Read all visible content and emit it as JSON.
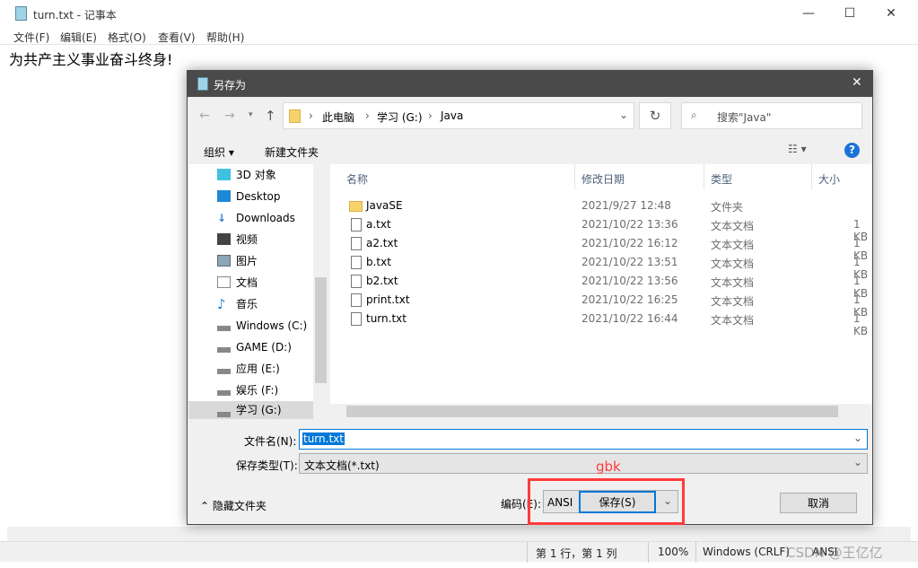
{
  "notepad": {
    "title": "turn.txt - 记事本",
    "menu": [
      "文件(F)",
      "编辑(E)",
      "格式(O)",
      "查看(V)",
      "帮助(H)"
    ],
    "content": "为共产主义事业奋斗终身!",
    "status": {
      "position": "第 1 行，第 1 列",
      "zoom": "100%",
      "line_ending": "Windows (CRLF)",
      "encoding": "ANSI"
    },
    "watermark": "CSDN @王亿亿"
  },
  "dialog": {
    "title": "另存为",
    "breadcrumb": [
      "此电脑",
      "学习 (G:)",
      "Java"
    ],
    "search_placeholder": "搜索\"Java\"",
    "organize": "组织",
    "new_folder": "新建文件夹",
    "nav": [
      "3D 对象",
      "Desktop",
      "Downloads",
      "视频",
      "图片",
      "文档",
      "音乐",
      "Windows (C:)",
      "GAME (D:)",
      "应用 (E:)",
      "娱乐 (F:)",
      "学习 (G:)"
    ],
    "columns": [
      "名称",
      "修改日期",
      "类型",
      "大小"
    ],
    "files": [
      {
        "name": "JavaSE",
        "date": "2021/9/27 12:48",
        "type": "文件夹",
        "size": ""
      },
      {
        "name": "a.txt",
        "date": "2021/10/22 13:36",
        "type": "文本文档",
        "size": "1 KB"
      },
      {
        "name": "a2.txt",
        "date": "2021/10/22 16:12",
        "type": "文本文档",
        "size": "1 KB"
      },
      {
        "name": "b.txt",
        "date": "2021/10/22 13:51",
        "type": "文本文档",
        "size": "1 KB"
      },
      {
        "name": "b2.txt",
        "date": "2021/10/22 13:56",
        "type": "文本文档",
        "size": "1 KB"
      },
      {
        "name": "print.txt",
        "date": "2021/10/22 16:25",
        "type": "文本文档",
        "size": "1 KB"
      },
      {
        "name": "turn.txt",
        "date": "2021/10/22 16:44",
        "type": "文本文档",
        "size": "1 KB"
      }
    ],
    "filename_label": "文件名(N):",
    "filename": "turn.txt",
    "type_label": "保存类型(T):",
    "type_value": "文本文档(*.txt)",
    "hide_folders": "隐藏文件夹",
    "encoding_label": "编码(E):",
    "encoding": "ANSI",
    "save": "保存(S)",
    "cancel": "取消",
    "annotation": "gbk",
    "annotation_color": "#ff3b3b"
  }
}
